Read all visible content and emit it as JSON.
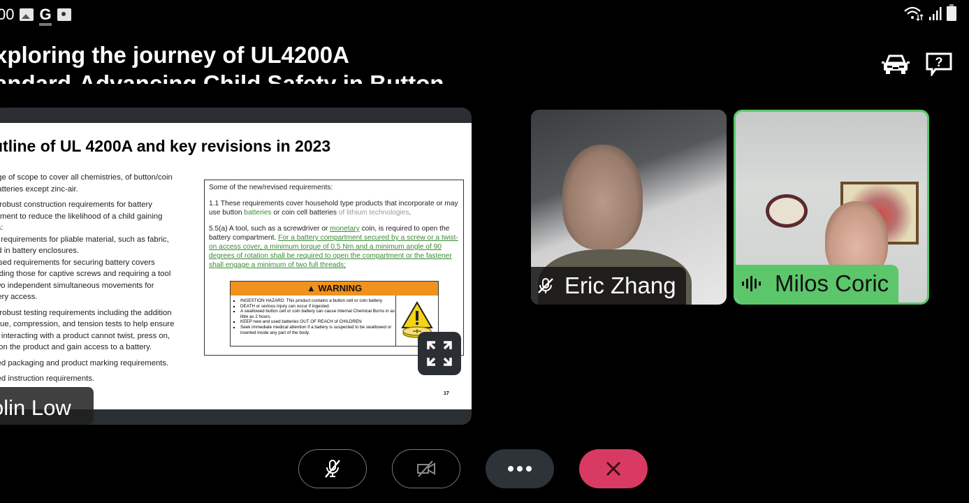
{
  "status_bar": {
    "time_partial": "00",
    "left_icons": [
      "image-icon",
      "google-icon",
      "camera-app-icon"
    ],
    "right_icons": [
      "wifi-icon",
      "signal-icon",
      "battery-icon"
    ]
  },
  "meeting": {
    "title_line1": "xploring the journey of UL4200A",
    "title_line2": "andard-Advancing Child Safety in Button",
    "actions": [
      "car-mode-icon",
      "help-icon"
    ]
  },
  "shared_slide": {
    "heading": "utline of UL 4200A and key revisions in 2023",
    "bullets": [
      {
        "text": "nge of scope to cover all chemistries, of button/coin",
        "cls": ""
      },
      {
        "text": "batteries except zinc-air.",
        "cls": ""
      },
      {
        "text": "e robust construction requirements for battery",
        "cls": ""
      },
      {
        "text": "rement to reduce the likelihood of a child gaining",
        "cls": ""
      },
      {
        "text": "ss:",
        "cls": ""
      },
      {
        "text": "w requirements for pliable material, such as fabric,",
        "cls": ""
      },
      {
        "text": "ed in battery enclosures.",
        "cls": ""
      },
      {
        "text": "vised requirements for securing battery covers",
        "cls": ""
      },
      {
        "text": "luding those for captive screws and requiring a tool",
        "cls": ""
      },
      {
        "text": "two independent simultaneous movements for",
        "cls": ""
      },
      {
        "text": "ttery access.",
        "cls": ""
      },
      {
        "text": "e robust testing requirements including the addition",
        "cls": ""
      },
      {
        "text": "rque, compression, and tension tests to help ensure",
        "cls": ""
      },
      {
        "text": "ld interacting with a product cannot twist, press on,",
        "cls": ""
      },
      {
        "text": "ll on the product and gain access to a battery.",
        "cls": ""
      },
      {
        "text": "sed packaging and product marking requirements.",
        "cls": ""
      },
      {
        "text": "sed instruction requirements.",
        "cls": ""
      }
    ],
    "requirements_box": {
      "intro": "Some of the new/revised requirements:",
      "req1_a": "1.1 These requirements cover household type products that incorporate or may use button ",
      "req1_green": "batteries",
      "req1_b": " or coin cell batteries ",
      "req1_grey": "of lithium technologies",
      "req1_c": ".",
      "req2_a": "5.5(a) A tool, such as a screwdriver or ",
      "req2_green": "monetary",
      "req2_b": " coin, is required to open the battery compartment. ",
      "req2_green_long": "For a battery compartment secured by a screw or a twist-on access cover, a minimum torque of 0.5 Nm and a minimum angle of 90 degrees of rotation shall be required to open the compartment or the fastener shall engage a minimum of two full threads;"
    },
    "warning": {
      "header": "WARNING",
      "items": [
        "INGESTION HAZARD: This product contains a button cell or coin battery.",
        "DEATH or serious injury can occur if ingested.",
        "A swallowed button cell or coin battery can cause Internal Chemical Burns in as little as 2 hours.",
        "KEEP new and used batteries OUT OF REACH of CHILDREN",
        "Seek immediate medical attention if a battery is suspected to be swallowed or inserted inside any part of the body."
      ]
    },
    "page_number": "17",
    "presenter_name": "olin Low"
  },
  "participants": [
    {
      "name": "Eric Zhang",
      "muted": true,
      "speaking": false
    },
    {
      "name": "Milos Coric",
      "muted": false,
      "speaking": true
    }
  ],
  "colors": {
    "speaking_green": "#5cc66a",
    "end_call_red": "#d93a63",
    "warning_orange": "#f0921e",
    "link_green": "#3a8a32"
  },
  "controls": [
    {
      "name": "mute-toggle",
      "icon": "mic-off-icon"
    },
    {
      "name": "camera-toggle",
      "icon": "video-off-icon"
    },
    {
      "name": "more-options",
      "icon": "more-dots-icon"
    },
    {
      "name": "leave-call",
      "icon": "close-icon"
    }
  ]
}
